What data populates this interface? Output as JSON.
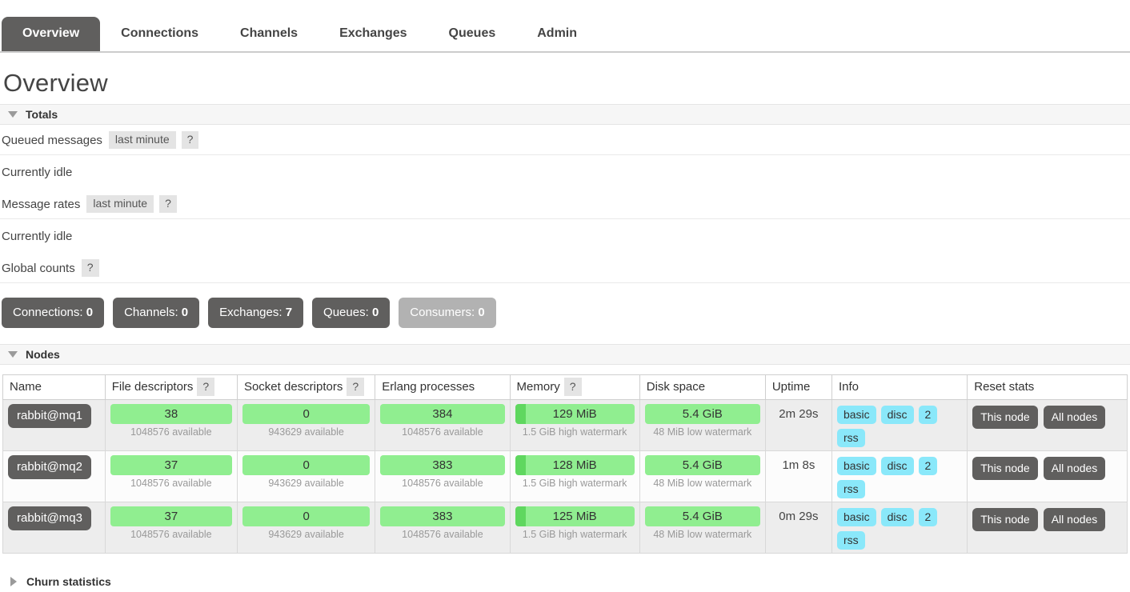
{
  "nav": {
    "tabs": [
      {
        "label": "Overview",
        "active": true
      },
      {
        "label": "Connections",
        "active": false
      },
      {
        "label": "Channels",
        "active": false
      },
      {
        "label": "Exchanges",
        "active": false
      },
      {
        "label": "Queues",
        "active": false
      },
      {
        "label": "Admin",
        "active": false
      }
    ]
  },
  "page": {
    "title": "Overview"
  },
  "totals": {
    "section_label": "Totals",
    "queued_messages": {
      "label": "Queued messages",
      "period_chip": "last minute",
      "help": "?",
      "status": "Currently idle"
    },
    "message_rates": {
      "label": "Message rates",
      "period_chip": "last minute",
      "help": "?",
      "status": "Currently idle"
    },
    "global_counts": {
      "label": "Global counts",
      "help": "?",
      "buttons": [
        {
          "label": "Connections:",
          "value": "0",
          "disabled": false
        },
        {
          "label": "Channels:",
          "value": "0",
          "disabled": false
        },
        {
          "label": "Exchanges:",
          "value": "7",
          "disabled": false
        },
        {
          "label": "Queues:",
          "value": "0",
          "disabled": false
        },
        {
          "label": "Consumers:",
          "value": "0",
          "disabled": true
        }
      ]
    }
  },
  "nodes": {
    "section_label": "Nodes",
    "columns": [
      {
        "label": "Name",
        "help": ""
      },
      {
        "label": "File descriptors",
        "help": "?"
      },
      {
        "label": "Socket descriptors",
        "help": "?"
      },
      {
        "label": "Erlang processes",
        "help": ""
      },
      {
        "label": "Memory",
        "help": "?"
      },
      {
        "label": "Disk space",
        "help": ""
      },
      {
        "label": "Uptime",
        "help": ""
      },
      {
        "label": "Info",
        "help": ""
      },
      {
        "label": "Reset stats",
        "help": ""
      }
    ],
    "rows": [
      {
        "name": "rabbit@mq1",
        "file_descriptors": {
          "value": "38",
          "sub": "1048576 available",
          "fill_pct": 0
        },
        "socket_descriptors": {
          "value": "0",
          "sub": "943629 available",
          "fill_pct": 0
        },
        "erlang_processes": {
          "value": "384",
          "sub": "1048576 available",
          "fill_pct": 0
        },
        "memory": {
          "value": "129 MiB",
          "sub": "1.5 GiB high watermark",
          "fill_pct": 9
        },
        "disk_space": {
          "value": "5.4 GiB",
          "sub": "48 MiB low watermark",
          "fill_pct": 0
        },
        "uptime": "2m 29s",
        "info": [
          "basic",
          "disc",
          "2",
          "rss"
        ],
        "reset": [
          "This node",
          "All nodes"
        ]
      },
      {
        "name": "rabbit@mq2",
        "file_descriptors": {
          "value": "37",
          "sub": "1048576 available",
          "fill_pct": 0
        },
        "socket_descriptors": {
          "value": "0",
          "sub": "943629 available",
          "fill_pct": 0
        },
        "erlang_processes": {
          "value": "383",
          "sub": "1048576 available",
          "fill_pct": 0
        },
        "memory": {
          "value": "128 MiB",
          "sub": "1.5 GiB high watermark",
          "fill_pct": 9
        },
        "disk_space": {
          "value": "5.4 GiB",
          "sub": "48 MiB low watermark",
          "fill_pct": 0
        },
        "uptime": "1m 8s",
        "info": [
          "basic",
          "disc",
          "2",
          "rss"
        ],
        "reset": [
          "This node",
          "All nodes"
        ]
      },
      {
        "name": "rabbit@mq3",
        "file_descriptors": {
          "value": "37",
          "sub": "1048576 available",
          "fill_pct": 0
        },
        "socket_descriptors": {
          "value": "0",
          "sub": "943629 available",
          "fill_pct": 0
        },
        "erlang_processes": {
          "value": "383",
          "sub": "1048576 available",
          "fill_pct": 0
        },
        "memory": {
          "value": "125 MiB",
          "sub": "1.5 GiB high watermark",
          "fill_pct": 9
        },
        "disk_space": {
          "value": "5.4 GiB",
          "sub": "48 MiB low watermark",
          "fill_pct": 0
        },
        "uptime": "0m 29s",
        "info": [
          "basic",
          "disc",
          "2",
          "rss"
        ],
        "reset": [
          "This node",
          "All nodes"
        ]
      }
    ]
  },
  "churn": {
    "section_label": "Churn statistics"
  },
  "colors": {
    "accent_dark": "#605f5e",
    "bar_green": "#90ee90",
    "bar_green_fill": "#5fd75f",
    "tag_cyan": "#8ae8fa",
    "chip_gray": "#e4e4e4",
    "disabled_gray": "#b2b2b2"
  }
}
